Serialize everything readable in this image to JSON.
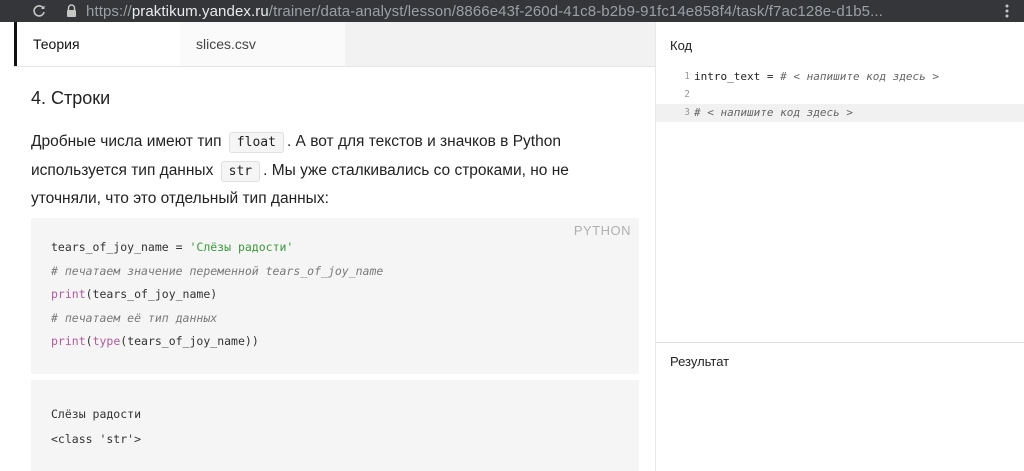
{
  "browser": {
    "url_scheme": "https://",
    "url_host": "praktikum.yandex.ru",
    "url_path": "/trainer/data-analyst/lesson/8866e43f-260d-41c8-b2b9-91fc14e858f4/task/f7ac128e-d1b5...",
    "reload_icon": "reload-icon",
    "lock_icon": "lock-icon",
    "menu_icon": "kebab-menu-icon"
  },
  "tabs": [
    {
      "label": "Теория",
      "active": true
    },
    {
      "label": "slices.csv",
      "active": false
    }
  ],
  "lesson": {
    "title": "4. Строки",
    "para_part1": "Дробные числа имеют тип",
    "code_float": "float",
    "para_part2": ". А вот для текстов и значков в Python используется тип данных",
    "code_str": "str",
    "para_part3": ". Мы уже сталкивались со строками, но не уточняли, что это отдельный тип данных:"
  },
  "code_example": {
    "language": "PYTHON",
    "line1_var": "tears_of_joy_name = ",
    "line1_str": "'Слёзы радости'",
    "line2_comment": "# печатаем значение переменной tears_of_joy_name",
    "line3_fn": "print",
    "line3_rest": "(tears_of_joy_name)",
    "line4_comment": "# печатаем её тип данных",
    "line5_fn": "print",
    "line5_open": "(",
    "line5_fn2": "type",
    "line5_rest": "(tears_of_joy_name))"
  },
  "output": {
    "line1": "Слёзы радости",
    "line2": "<class 'str'>"
  },
  "editor": {
    "title": "Код",
    "lines": [
      {
        "num": "1",
        "code": "intro_text = ",
        "comment": "# < напишите код здесь >"
      },
      {
        "num": "2",
        "code": "",
        "comment": ""
      },
      {
        "num": "3",
        "code": "",
        "comment": "# < напишите код здесь >"
      }
    ]
  },
  "result": {
    "title": "Результат"
  },
  "colors": {
    "address_bar": "#35363a",
    "string_green": "#3b9a3b",
    "builtin_purple": "#b05a9a",
    "code_bg": "#f5f5f5"
  }
}
